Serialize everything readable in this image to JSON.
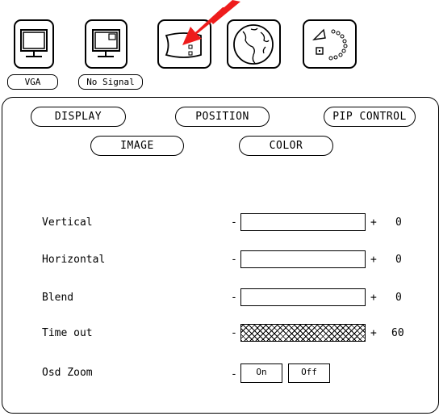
{
  "top_icons": {
    "vga_label": "VGA",
    "no_signal_label": "No Signal"
  },
  "tabs": {
    "display": "DISPLAY",
    "position": "POSITION",
    "pip_control": "PIP CONTROL",
    "image": "IMAGE",
    "color": "COLOR"
  },
  "controls": [
    {
      "label": "Vertical",
      "value": "0",
      "fill_fraction": 0
    },
    {
      "label": "Horizontal",
      "value": "0",
      "fill_fraction": 0
    },
    {
      "label": "Blend",
      "value": "0",
      "fill_fraction": 0
    },
    {
      "label": "Time out",
      "value": "60",
      "fill_fraction": 1
    }
  ],
  "osd_zoom": {
    "label": "Osd Zoom",
    "on_label": "On",
    "off_label": "Off"
  },
  "symbols": {
    "minus": "-",
    "plus": "+"
  },
  "colors": {
    "pointer_arrow": "#ee1c1c"
  }
}
